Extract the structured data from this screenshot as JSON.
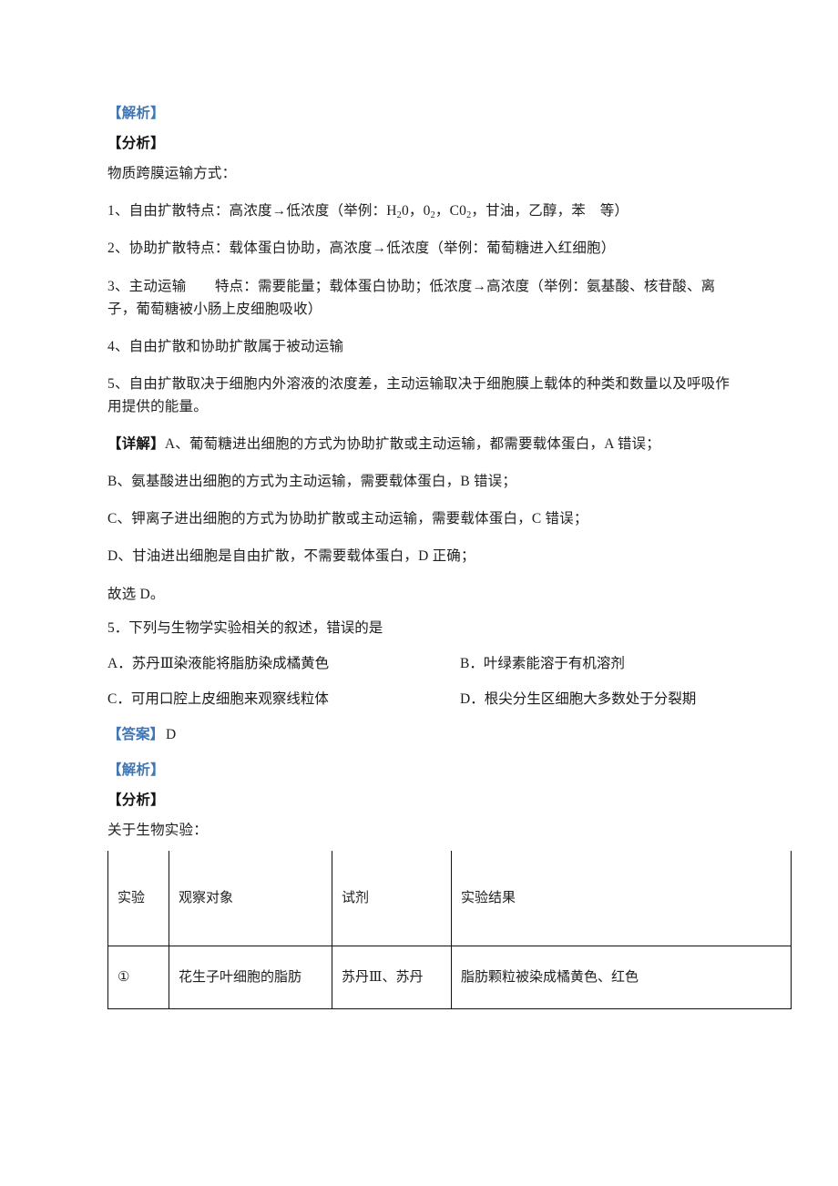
{
  "document": {
    "sections": {
      "explanation_tag": "【解析】",
      "analysis_tag": "【分析】",
      "detail_tag": "【详解】",
      "answer_tag": "【答案】"
    },
    "q4_explanation": {
      "topic_heading": "物质跨膜运输方式：",
      "points": [
        "1、自由扩散特点：高浓度→低浓度（举例：H",
        "2、协助扩散特点：载体蛋白协助，高浓度→低浓度（举例：葡萄糖进入红细胞）",
        "3、主动运输　　特点：需要能量；载体蛋白协助；低浓度→高浓度（举例：氨基酸、核苷酸、离子，葡萄糖被小肠上皮细胞吸收）",
        "4、自由扩散和协助扩散属于被动运输",
        "5、自由扩散取决于细胞内外溶液的浓度差，主动运输取决于细胞膜上载体的种类和数量以及呼吸作用提供的能量。"
      ],
      "point1_parts": {
        "prefix": "1、自由扩散特点：高浓度→低浓度（举例：H",
        "sub1": "2",
        "mid1": "0，0",
        "sub2": "2",
        "mid2": "，C0",
        "sub3": "2",
        "suffix": "，甘油，乙醇，苯　等）"
      },
      "detail_items": [
        "A、葡萄糖进出细胞的方式为协助扩散或主动运输，都需要载体蛋白，A 错误；",
        "B、氨基酸进出细胞的方式为主动运输，需要载体蛋白，B 错误；",
        "C、钾离子进出细胞的方式为协助扩散或主动运输，需要载体蛋白，C 错误；",
        "D、甘油进出细胞是自由扩散，不需要载体蛋白，D 正确；"
      ],
      "conclusion": "故选 D。"
    },
    "question5": {
      "number": "5．",
      "stem": "下列与生物学实验相关的叙述，错误的是",
      "options": [
        {
          "label": "A．",
          "text": "苏丹Ⅲ染液能将脂肪染成橘黄色"
        },
        {
          "label": "B．",
          "text": "叶绿素能溶于有机溶剂"
        },
        {
          "label": "C．",
          "text": "可用口腔上皮细胞来观察线粒体"
        },
        {
          "label": "D．",
          "text": "根尖分生区细胞大多数处于分裂期"
        }
      ],
      "answer": "D",
      "analysis_intro": "关于生物实验："
    },
    "experiment_table": {
      "headers": [
        "实验",
        "观察对象",
        "试剂",
        "实验结果"
      ],
      "rows": [
        {
          "no": "①",
          "object": "花生子叶细胞的脂肪",
          "reagent": "苏丹Ⅲ、苏丹",
          "result": "脂肪颗粒被染成橘黄色、红色"
        }
      ]
    },
    "colors": {
      "tag_blue": "#4076b4",
      "text": "#1f1f1f",
      "border": "#111111"
    }
  }
}
